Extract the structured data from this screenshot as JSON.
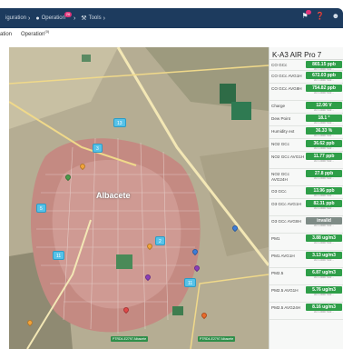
{
  "nav": {
    "items": [
      {
        "label": "iguration",
        "icon": "chevron-icon"
      },
      {
        "label": "Operation",
        "icon": "people-icon",
        "badge": "26"
      },
      {
        "label": "Tools",
        "icon": "wrench-icon"
      }
    ],
    "bell_badge": "",
    "icons": [
      "bell-icon",
      "help-icon",
      "user-icon"
    ],
    "bar_color": "#1d3b5e"
  },
  "subtabs": [
    {
      "label": "ation"
    },
    {
      "label": "Operation",
      "sup": "(0)"
    }
  ],
  "map": {
    "city_label": "Albacete",
    "clusters": [
      {
        "label": "13"
      },
      {
        "label": "3"
      },
      {
        "label": "2"
      },
      {
        "label": "11"
      },
      {
        "label": "5"
      },
      {
        "label": "11"
      }
    ],
    "bottom_badges": [
      "PTRD4-E2797 Albacete",
      "PTRD4-E2797 Albacete"
    ],
    "pin_colors": [
      "#f2a33a",
      "#3d7dd8",
      "#8b3fb8",
      "#e04848",
      "#e86a2b",
      "#4b9b4b"
    ]
  },
  "panel": {
    "title": "K-A3 AIR Pro 7",
    "accent": "#2e9e48",
    "rows": [
      {
        "label": "CO GCc",
        "value": "865.15 ppb",
        "meta": "Vol: 1.0000 7/13/...."
      },
      {
        "label": "CO GCc AVG1H",
        "value": "672.03 ppb",
        "meta": "Vol: 1.0000 7/13/...."
      },
      {
        "label": "CO GCc AVG8H",
        "value": "754.82 ppb",
        "meta": "Vol: 1.0000 7/13/...."
      },
      {
        "label": "Charge",
        "value": "12.06 V",
        "meta": "Vol: 1.0000 7/13/...."
      },
      {
        "label": "Dew Point",
        "value": "18.1 °",
        "meta": "Vol: 1.0000 7/13/...."
      },
      {
        "label": "Humidity ext",
        "value": "36.33 %",
        "meta": "Vol: 1.0000 7/13/...."
      },
      {
        "label": "NO2 GCc",
        "value": "36.62 ppb",
        "meta": "Vol: 1.0000 7/13/...."
      },
      {
        "label": "NO2 GCc AVG1H",
        "value": "11.77 ppb",
        "meta": "Vol: 1.0000 7/13/...."
      },
      {
        "label": "NO2 GCc AVG24H",
        "value": "27.8 ppb",
        "meta": "Vol: 1.0000 7/13/...."
      },
      {
        "label": "O3 GCc",
        "value": "13.96 ppb",
        "meta": "Vol: 1.0000 7/13/...."
      },
      {
        "label": "O3 GCc AVG1H",
        "value": "82.31 ppb",
        "meta": "Vol: 1.0000 7/13/...."
      },
      {
        "label": "O3 GCc AVG8H",
        "value": "invalid",
        "meta": "Vol: 1.0000 7/13/...."
      },
      {
        "label": "PM1",
        "value": "3.88 ug/m3",
        "meta": "Vol: 1.0000 7/13/...."
      },
      {
        "label": "PM1 AVG1H",
        "value": "3.13 ug/m3",
        "meta": "Vol: 1.0000 7/13/...."
      },
      {
        "label": "PM2.5",
        "value": "6.87 ug/m3",
        "meta": "Vol: 1.0000 7/13/...."
      },
      {
        "label": "PM2.5 AVG1H",
        "value": "5.76 ug/m3",
        "meta": "Vol: 1.0000 7/13/...."
      },
      {
        "label": "PM2.5 AVG24H",
        "value": "8.16 ug/m3",
        "meta": "Vol: 1.0000 7/13/...."
      }
    ]
  }
}
